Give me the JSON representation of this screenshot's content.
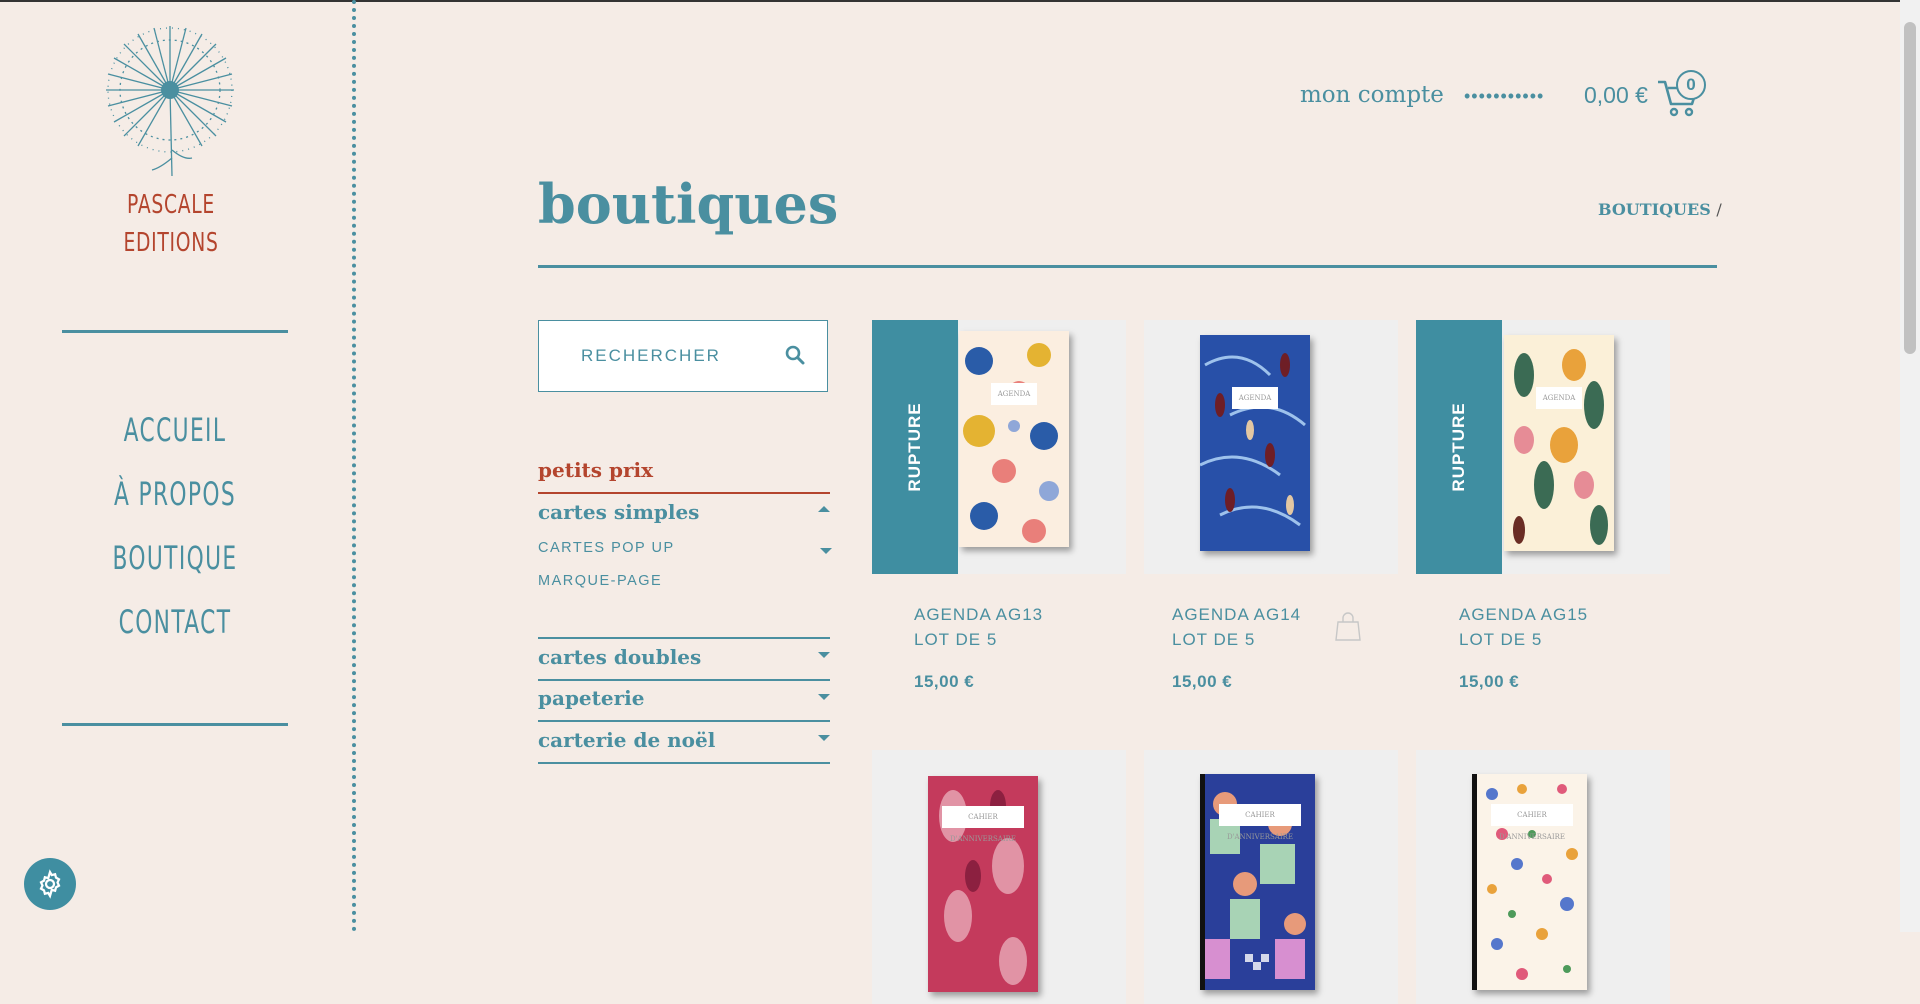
{
  "brand": {
    "line1": "PASCALE",
    "line2": "EDITIONS"
  },
  "nav": [
    "ACCUEIL",
    "À PROPOS",
    "BOUTIQUE",
    "CONTACT"
  ],
  "header": {
    "account": "mon compte",
    "dots": "•••••••••••",
    "amount": "0,00 €",
    "cart_count": "0"
  },
  "page": {
    "title": "boutiques",
    "breadcrumb": "BOUTIQUES",
    "breadcrumb_sep": "/"
  },
  "search": {
    "placeholder": "RECHERCHER"
  },
  "categories": {
    "petits_prix": "petits prix",
    "cartes_simples": "cartes simples",
    "sub1": "CARTES POP UP",
    "sub2": "MARQUE-PAGE",
    "cartes_doubles": "cartes doubles",
    "papeterie": "papeterie",
    "carterie": "carterie de noël"
  },
  "products": [
    {
      "name": "AGENDA AG13",
      "lot": "LOT DE 5",
      "price": "15,00 €",
      "ribbon": "RUPTURE",
      "cover_tag": "AGENDA"
    },
    {
      "name": "AGENDA AG14",
      "lot": "LOT DE 5",
      "price": "15,00 €",
      "cover_tag": "AGENDA"
    },
    {
      "name": "AGENDA AG15",
      "lot": "LOT DE 5",
      "price": "15,00 €",
      "ribbon": "RUPTURE",
      "cover_tag": "AGENDA"
    },
    {
      "cover_tag": "CAHIER D'ANNIVERSAIRE"
    },
    {
      "cover_tag": "CAHIER D'ANNIVERSAIRE"
    },
    {
      "cover_tag": "CAHIER D'ANNIVERSAIRE"
    }
  ],
  "colors": {
    "accent": "#4a8fa0",
    "brand_red": "#b4452e",
    "background": "#f5ece6"
  }
}
